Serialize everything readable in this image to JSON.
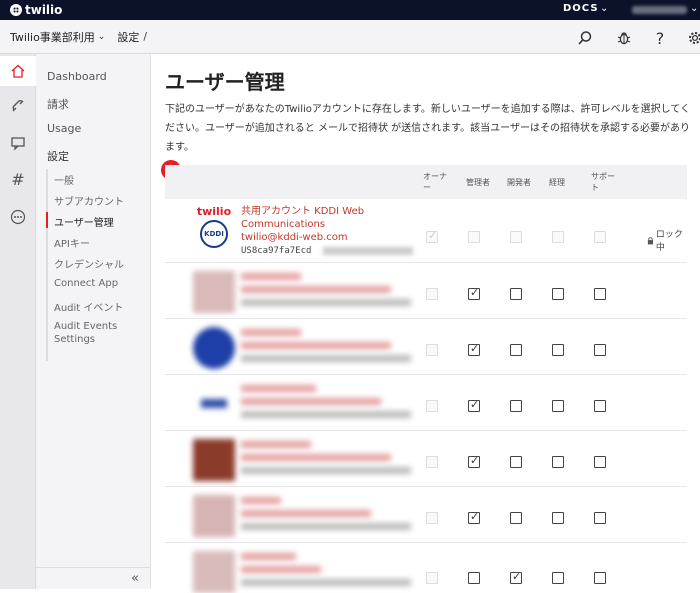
{
  "topbar": {
    "logo_text": "twilio",
    "docs_label": "DOCS",
    "docs_chevron": "⌄",
    "account_chevron": "⌄"
  },
  "breadcrumb": {
    "project": "Twilio事業部利用",
    "project_chevron": "⌄",
    "settings": "設定",
    "separator": "/"
  },
  "toolbar": {
    "search_icon": "search-icon",
    "bug_icon": "bug-icon",
    "help_label": "?",
    "gear_icon": "gear-icon"
  },
  "rail": [
    {
      "icon": "home-icon"
    },
    {
      "icon": "phone-icon"
    },
    {
      "icon": "chat-icon"
    },
    {
      "icon": "hash-icon"
    },
    {
      "icon": "more-icon"
    }
  ],
  "sidenav": {
    "top_items": [
      "Dashboard",
      "請求",
      "Usage",
      "設定"
    ],
    "sub_items": [
      "一般",
      "サブアカウント",
      "ユーザー管理",
      "APIキー",
      "クレデンシャル",
      "Connect App",
      "Audit イベント",
      "Audit Events Settings"
    ],
    "active_sub": "ユーザー管理",
    "collapse_label": "«"
  },
  "page": {
    "title": "ユーザー管理",
    "description": "下記のユーザーがあなたのTwilioアカウントに存在します。新しいユーザーを追加する際は、許可レベルを選択してください。ユーザーが追加されると メールで招待状 が送信されます。該当ユーザーはその招待状を承認する必要があります。",
    "add_button": "+"
  },
  "table": {
    "columns": [
      "オーナー",
      "管理者",
      "開発者",
      "経理",
      "サポート"
    ],
    "rows": [
      {
        "name": "共用アカウント KDDI Web Communications",
        "email": "twilio@kddi-web.com",
        "sid": "US8ca97fa7Ecd",
        "logo_text_top": "twilio",
        "logo_text_bottom": "KDDI",
        "owner": true,
        "admin": false,
        "developer": false,
        "billing": false,
        "support": false,
        "locked": true,
        "lock_label": "ロック中",
        "avatar_color": "#ffffff"
      },
      {
        "owner": false,
        "admin": true,
        "developer": false,
        "billing": false,
        "support": false,
        "avatar_color": "#d9b9b9"
      },
      {
        "owner": false,
        "admin": true,
        "developer": false,
        "billing": false,
        "support": false,
        "avatar_color": "#1f3fa8"
      },
      {
        "owner": false,
        "admin": true,
        "developer": false,
        "billing": false,
        "support": false,
        "avatar_color": "#2d4ea8"
      },
      {
        "owner": false,
        "admin": true,
        "developer": false,
        "billing": false,
        "support": false,
        "avatar_color": "#8b3b2a"
      },
      {
        "owner": false,
        "admin": true,
        "developer": false,
        "billing": false,
        "support": false,
        "avatar_color": "#d6b4b4"
      },
      {
        "owner": false,
        "admin": false,
        "developer": true,
        "billing": false,
        "support": false,
        "avatar_color": "#d9bbbb"
      }
    ]
  },
  "colors": {
    "accent": "#e31e26",
    "topbar": "#0d122b",
    "link": "#c0392b"
  }
}
